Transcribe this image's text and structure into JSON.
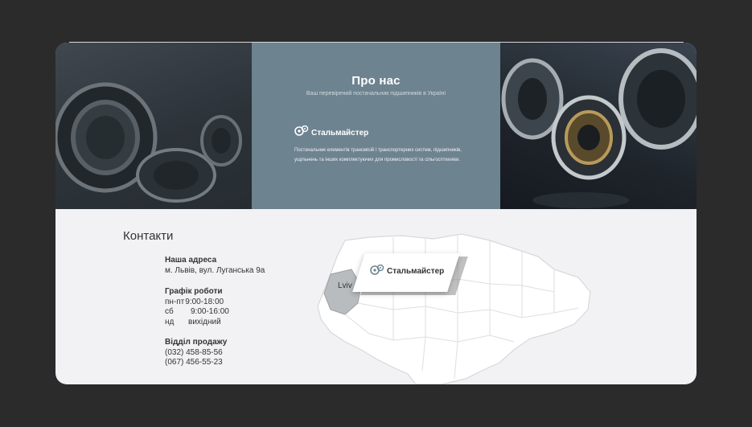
{
  "about": {
    "title": "Про нас",
    "subtitle": "Ваш перевірений постачальник підшипників в Україні",
    "brand": "Стальмайстер",
    "description": "Постачальник елементів трансмісій і транспортерних систем, підшипників, ущільнень та інших комплектуючих для промисловості та сільгосптехніки."
  },
  "contacts": {
    "title": "Контакти",
    "address_label": "Наша адреса",
    "address_value": "м. Львів, вул. Луганська 9а",
    "schedule_label": "Графік роботи",
    "schedule": [
      {
        "day": "пн-пт",
        "time": "9:00-18:00"
      },
      {
        "day": "сб",
        "time": "9:00-16:00"
      },
      {
        "day": "нд",
        "time": "вихідний"
      }
    ],
    "sales_label": "Відділ продажу",
    "phones": [
      "(032) 458-85-56",
      "(067) 456-55-23"
    ]
  },
  "map": {
    "city_label": "Lviv",
    "brand": "Стальмайстер",
    "region_color": "#b8bcbf",
    "country_color": "#ffffff"
  },
  "colors": {
    "background": "#2b2b2b",
    "about_panel": "#6e8390",
    "card": "#f2f2f4"
  }
}
